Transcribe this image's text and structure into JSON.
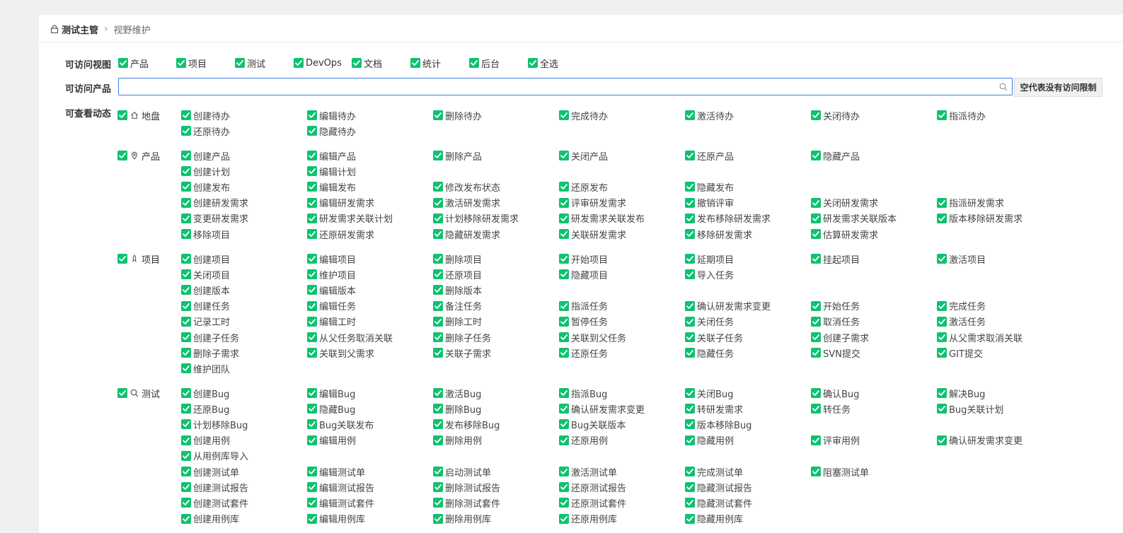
{
  "breadcrumb": {
    "parent": "测试主管",
    "separator": "›",
    "current": "视野维护"
  },
  "labels": {
    "views": "可访问视图",
    "products": "可访问产品",
    "actions": "可查看动态"
  },
  "colors": {
    "checkbox": "#0ec270",
    "input_border": "#3d7de0"
  },
  "views": [
    "产品",
    "项目",
    "测试",
    "DevOps",
    "文档",
    "统计",
    "后台",
    "全选"
  ],
  "product_input": {
    "value": "",
    "placeholder": ""
  },
  "no_acl_button": "空代表没有访问限制",
  "modules": [
    {
      "label": "地盘",
      "icon": "home-icon",
      "rows": [
        [
          "创建待办",
          "编辑待办",
          "删除待办",
          "完成待办",
          "激活待办",
          "关闭待办",
          "指派待办"
        ],
        [
          "还原待办",
          "隐藏待办"
        ]
      ]
    },
    {
      "label": "产品",
      "icon": "location-icon",
      "rows": [
        [
          "创建产品",
          "编辑产品",
          "删除产品",
          "关闭产品",
          "还原产品",
          "隐藏产品"
        ],
        [
          "创建计划",
          "编辑计划"
        ],
        [
          "创建发布",
          "编辑发布",
          "修改发布状态",
          "还原发布",
          "隐藏发布"
        ],
        [
          "创建研发需求",
          "编辑研发需求",
          "激活研发需求",
          "评审研发需求",
          "撤销评审",
          "关闭研发需求",
          "指派研发需求"
        ],
        [
          "变更研发需求",
          "研发需求关联计划",
          "计划移除研发需求",
          "研发需求关联发布",
          "发布移除研发需求",
          "研发需求关联版本",
          "版本移除研发需求"
        ],
        [
          "移除项目",
          "还原研发需求",
          "隐藏研发需求",
          "关联研发需求",
          "移除研发需求",
          "估算研发需求"
        ]
      ]
    },
    {
      "label": "项目",
      "icon": "rocket-icon",
      "rows": [
        [
          "创建项目",
          "编辑项目",
          "删除项目",
          "开始项目",
          "延期项目",
          "挂起项目",
          "激活项目"
        ],
        [
          "关闭项目",
          "维护项目",
          "还原项目",
          "隐藏项目",
          "导入任务"
        ],
        [
          "创建版本",
          "编辑版本",
          "删除版本"
        ],
        [
          "创建任务",
          "编辑任务",
          "备注任务",
          "指派任务",
          "确认研发需求变更",
          "开始任务",
          "完成任务"
        ],
        [
          "记录工时",
          "编辑工时",
          "删除工时",
          "暂停任务",
          "关闭任务",
          "取消任务",
          "激活任务"
        ],
        [
          "创建子任务",
          "从父任务取消关联",
          "删除子任务",
          "关联到父任务",
          "关联子任务",
          "创建子需求",
          "从父需求取消关联"
        ],
        [
          "删除子需求",
          "关联到父需求",
          "关联子需求",
          "还原任务",
          "隐藏任务",
          "SVN提交",
          "GIT提交"
        ],
        [
          "维护团队"
        ]
      ]
    },
    {
      "label": "测试",
      "icon": "search-icon",
      "rows": [
        [
          "创建Bug",
          "编辑Bug",
          "激活Bug",
          "指派Bug",
          "关闭Bug",
          "确认Bug",
          "解决Bug"
        ],
        [
          "还原Bug",
          "隐藏Bug",
          "删除Bug",
          "确认研发需求变更",
          "转研发需求",
          "转任务",
          "Bug关联计划"
        ],
        [
          "计划移除Bug",
          "Bug关联发布",
          "发布移除Bug",
          "Bug关联版本",
          "版本移除Bug"
        ],
        [
          "创建用例",
          "编辑用例",
          "删除用例",
          "还原用例",
          "隐藏用例",
          "评审用例",
          "确认研发需求变更"
        ],
        [
          "从用例库导入"
        ],
        [
          "创建测试单",
          "编辑测试单",
          "启动测试单",
          "激活测试单",
          "完成测试单",
          "阻塞测试单"
        ],
        [
          "创建测试报告",
          "编辑测试报告",
          "删除测试报告",
          "还原测试报告",
          "隐藏测试报告"
        ],
        [
          "创建测试套件",
          "编辑测试套件",
          "删除测试套件",
          "还原测试套件",
          "隐藏测试套件"
        ],
        [
          "创建用例库",
          "编辑用例库",
          "删除用例库",
          "还原用例库",
          "隐藏用例库"
        ]
      ]
    }
  ]
}
